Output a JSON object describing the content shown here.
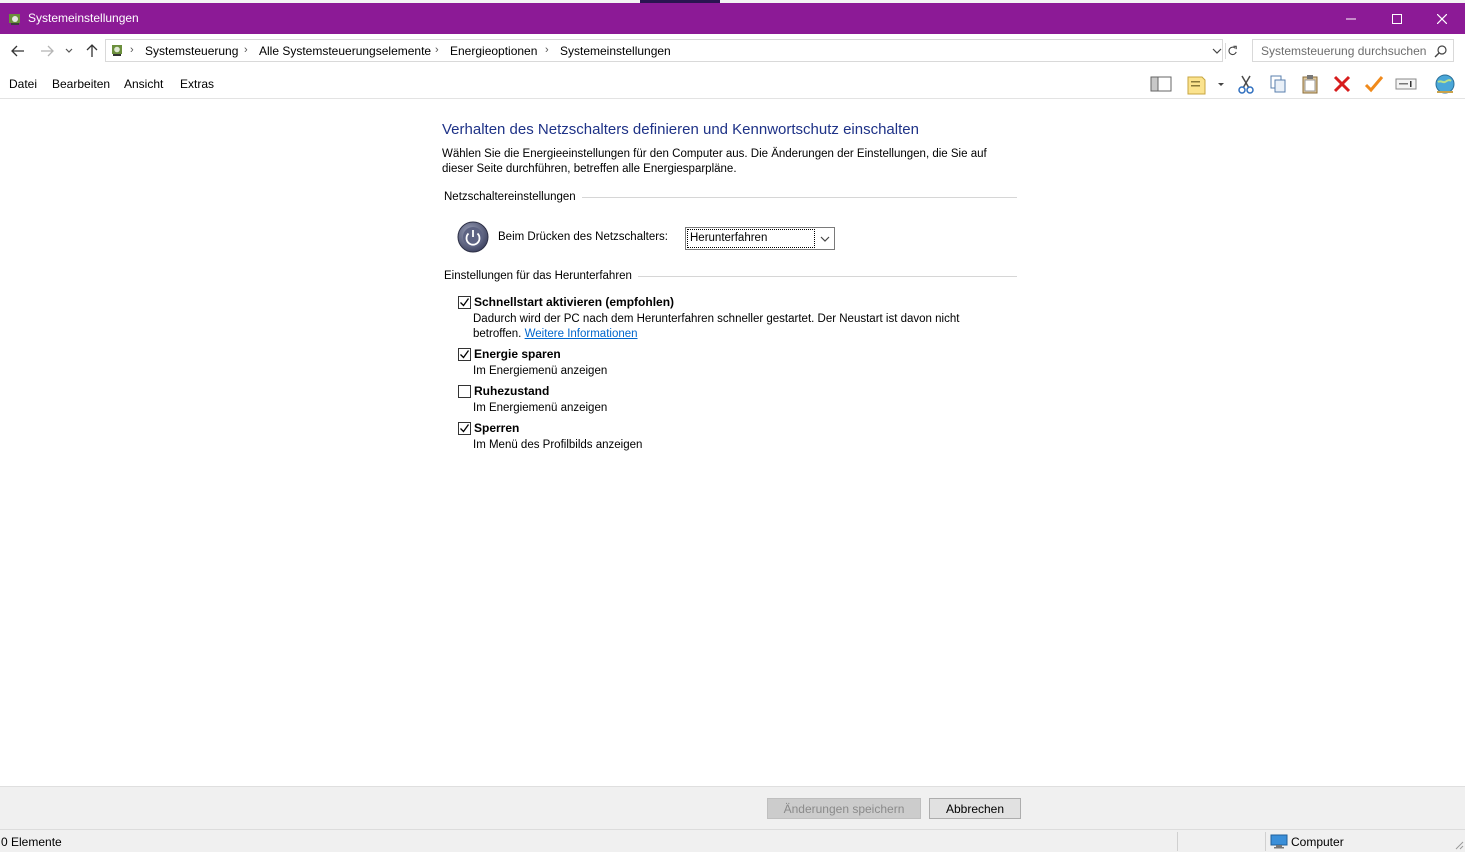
{
  "window": {
    "title": "Systemeinstellungen",
    "title_bar_color": "#8c1a96"
  },
  "address": {
    "breadcrumbs": [
      "Systemsteuerung",
      "Alle Systemsteuerungselemente",
      "Energieoptionen",
      "Systemeinstellungen"
    ],
    "search_placeholder": "Systemsteuerung durchsuchen"
  },
  "menu": {
    "items": [
      "Datei",
      "Bearbeiten",
      "Ansicht",
      "Extras"
    ]
  },
  "toolbar": {
    "icons": [
      "layout-pane-icon",
      "properties-icon",
      "cut-icon",
      "copy-icon",
      "paste-icon",
      "delete-icon",
      "checkmark-icon",
      "rename-icon",
      "globe-icon"
    ]
  },
  "page": {
    "title": "Verhalten des Netzschalters definieren und Kennwortschutz einschalten",
    "description": "Wählen Sie die Energieeinstellungen für den Computer aus. Die Änderungen der Einstellungen, die Sie auf dieser Seite durchführen, betreffen alle Energiesparpläne."
  },
  "power_button_section": {
    "heading": "Netzschaltereinstellungen",
    "label": "Beim Drücken des Netzschalters:",
    "selected": "Herunterfahren"
  },
  "shutdown_section": {
    "heading": "Einstellungen für das Herunterfahren",
    "options": [
      {
        "title": "Schnellstart aktivieren (empfohlen)",
        "description": "Dadurch wird der PC nach dem Herunterfahren schneller gestartet. Der Neustart ist davon nicht betroffen.",
        "link": "Weitere Informationen",
        "checked": true
      },
      {
        "title": "Energie sparen",
        "description": "Im Energiemenü anzeigen",
        "checked": true
      },
      {
        "title": "Ruhezustand",
        "description": "Im Energiemenü anzeigen",
        "checked": false
      },
      {
        "title": "Sperren",
        "description": "Im Menü des Profilbilds anzeigen",
        "checked": true
      }
    ]
  },
  "buttons": {
    "save": "Änderungen speichern",
    "cancel": "Abbrechen"
  },
  "status": {
    "items_count": "0 Elemente",
    "location": "Computer"
  }
}
